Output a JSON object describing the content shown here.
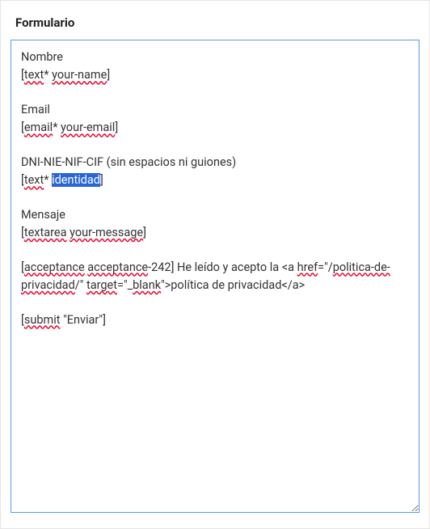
{
  "panel": {
    "title": "Formulario"
  },
  "form_source": {
    "blocks": [
      {
        "label": {
          "text": "Nombre",
          "spell": false
        },
        "tag_parts": [
          {
            "t": "[",
            "spell": false
          },
          {
            "t": "text",
            "spell": true
          },
          {
            "t": "* ",
            "spell": false
          },
          {
            "t": "your-name",
            "spell": true
          },
          {
            "t": "]",
            "spell": false
          }
        ]
      },
      {
        "label": {
          "text": "Email",
          "spell": false
        },
        "tag_parts": [
          {
            "t": "[",
            "spell": false
          },
          {
            "t": "email",
            "spell": true
          },
          {
            "t": "* ",
            "spell": false
          },
          {
            "t": "your-email",
            "spell": true
          },
          {
            "t": "]",
            "spell": false
          }
        ]
      },
      {
        "label": {
          "text": "DNI-NIE-NIF-CIF (sin espacios ni guiones)",
          "spell": false
        },
        "tag_parts": [
          {
            "t": "[",
            "spell": false
          },
          {
            "t": "text",
            "spell": true
          },
          {
            "t": "* ",
            "spell": false
          },
          {
            "t": "identidad",
            "selected": true
          },
          {
            "t": "]",
            "spell": false
          }
        ]
      },
      {
        "label": {
          "text": "Mensaje",
          "spell": false
        },
        "tag_parts": [
          {
            "t": "[",
            "spell": false
          },
          {
            "t": "textarea",
            "spell": true
          },
          {
            "t": " ",
            "spell": false
          },
          {
            "t": "your-message",
            "spell": true
          },
          {
            "t": "]",
            "spell": false
          }
        ]
      },
      {
        "full_parts": [
          {
            "t": "[",
            "spell": false
          },
          {
            "t": "acceptance",
            "spell": true
          },
          {
            "t": " ",
            "spell": false
          },
          {
            "t": "acceptance",
            "spell": true
          },
          {
            "t": "-242] He ",
            "spell": false
          },
          {
            "t": "leído",
            "spell": false
          },
          {
            "t": " y acepto la <a ",
            "spell": false
          },
          {
            "t": "href",
            "spell": true
          },
          {
            "t": "=\"/",
            "spell": false
          },
          {
            "t": "politica-de-privacidad",
            "spell": true
          },
          {
            "t": "/\" ",
            "spell": false
          },
          {
            "t": "target",
            "spell": true
          },
          {
            "t": "=\"_",
            "spell": false
          },
          {
            "t": "blank",
            "spell": true
          },
          {
            "t": "\">política de privacidad</a>",
            "spell": false
          }
        ]
      },
      {
        "full_parts": [
          {
            "t": "[",
            "spell": false
          },
          {
            "t": "submit",
            "spell": true
          },
          {
            "t": " \"Enviar\"]",
            "spell": false
          }
        ]
      }
    ]
  }
}
